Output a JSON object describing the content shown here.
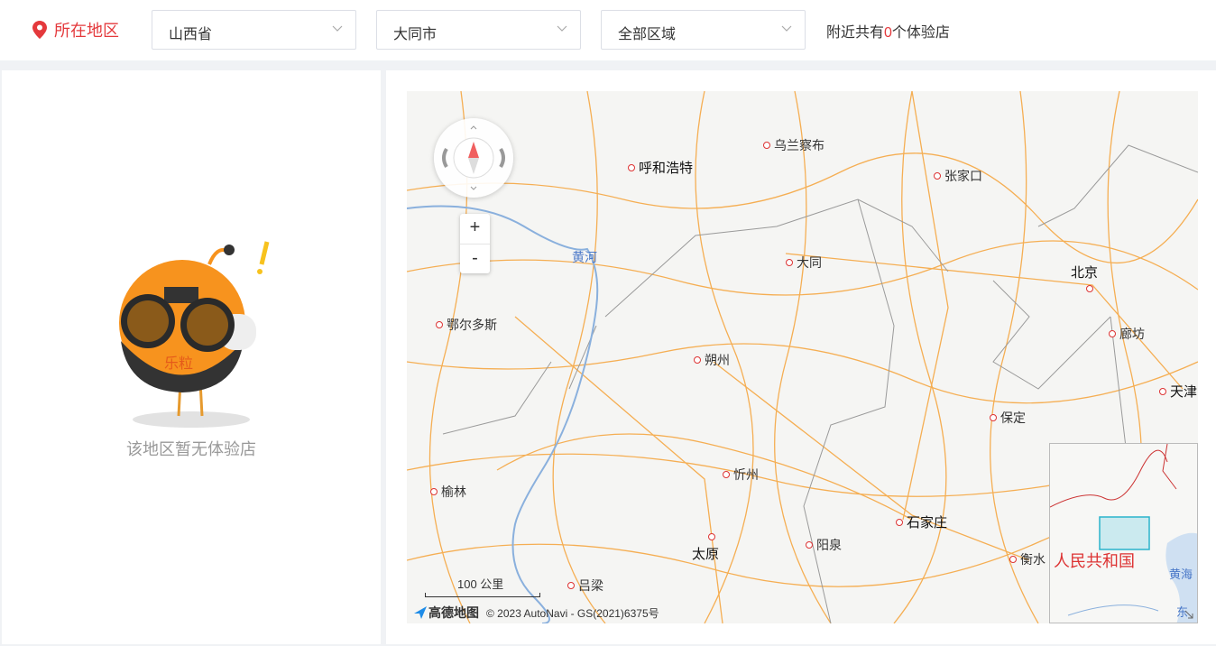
{
  "header": {
    "location_label": "所在地区",
    "province": "山西省",
    "city": "大同市",
    "district": "全部区域",
    "count_prefix": "附近共有",
    "count_value": "0",
    "count_suffix": "个体验店"
  },
  "left": {
    "empty_message": "该地区暂无体验店",
    "mascot_badge": "乐粒"
  },
  "map": {
    "zoom_in": "+",
    "zoom_out": "-",
    "scale_label": "100 公里",
    "copyright": "© 2023 AutoNavi - GS(2021)6375号",
    "brand": "高德地图",
    "cities": {
      "wulanchabu": "乌兰察布",
      "huhehaote": "呼和浩特",
      "zhangjiakou": "张家口",
      "datong": "大同",
      "beijing": "北京",
      "eerduosi": "鄂尔多斯",
      "langfang": "廊坊",
      "shuozhou": "朔州",
      "tianjin": "天津",
      "baoding": "保定",
      "xinzhou": "忻州",
      "yulin": "榆林",
      "shijiazhuang": "石家庄",
      "taiyuan": "太原",
      "yangquan": "阳泉",
      "hengshui": "衡水",
      "lvliang": "吕梁"
    },
    "river": "黄河",
    "overview": {
      "country": "人民共和国",
      "sea1": "黄海",
      "sea2": "东海"
    }
  }
}
